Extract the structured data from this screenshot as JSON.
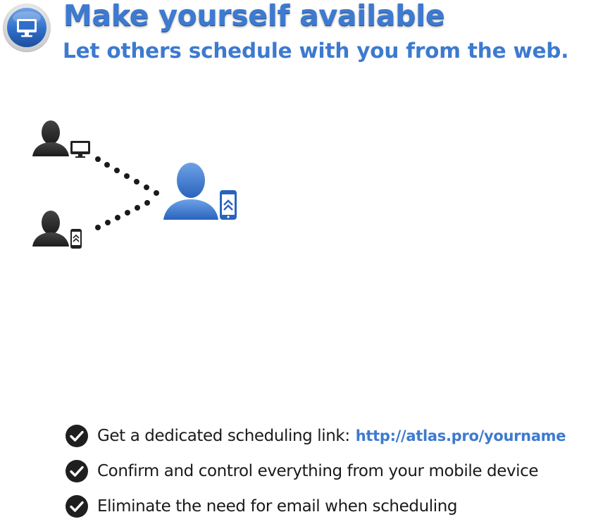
{
  "header": {
    "icon": "desktop-monitor-icon",
    "title": "Make yourself available",
    "subtitle": "Let others schedule with you from the web."
  },
  "diagram": {
    "people": [
      {
        "role": "guest",
        "device": "desktop-monitor-icon",
        "color": "#2b2b2b"
      },
      {
        "role": "guest",
        "device": "mobile-phone-icon",
        "color": "#2b2b2b"
      },
      {
        "role": "host",
        "device": "mobile-phone-icon",
        "color": "#3a78cf"
      }
    ],
    "connector": "dotted-line"
  },
  "features": [
    {
      "icon": "checkmark-icon",
      "text": "Get a dedicated scheduling link:",
      "link": "http://atlas.pro/yourname"
    },
    {
      "icon": "checkmark-icon",
      "text": "Confirm and control everything from your mobile device"
    },
    {
      "icon": "checkmark-icon",
      "text": "Eliminate the need for email when scheduling"
    }
  ],
  "colors": {
    "brand_blue": "#3d7ad0",
    "dark": "#2b2b2b",
    "text": "#1a1a1a"
  }
}
